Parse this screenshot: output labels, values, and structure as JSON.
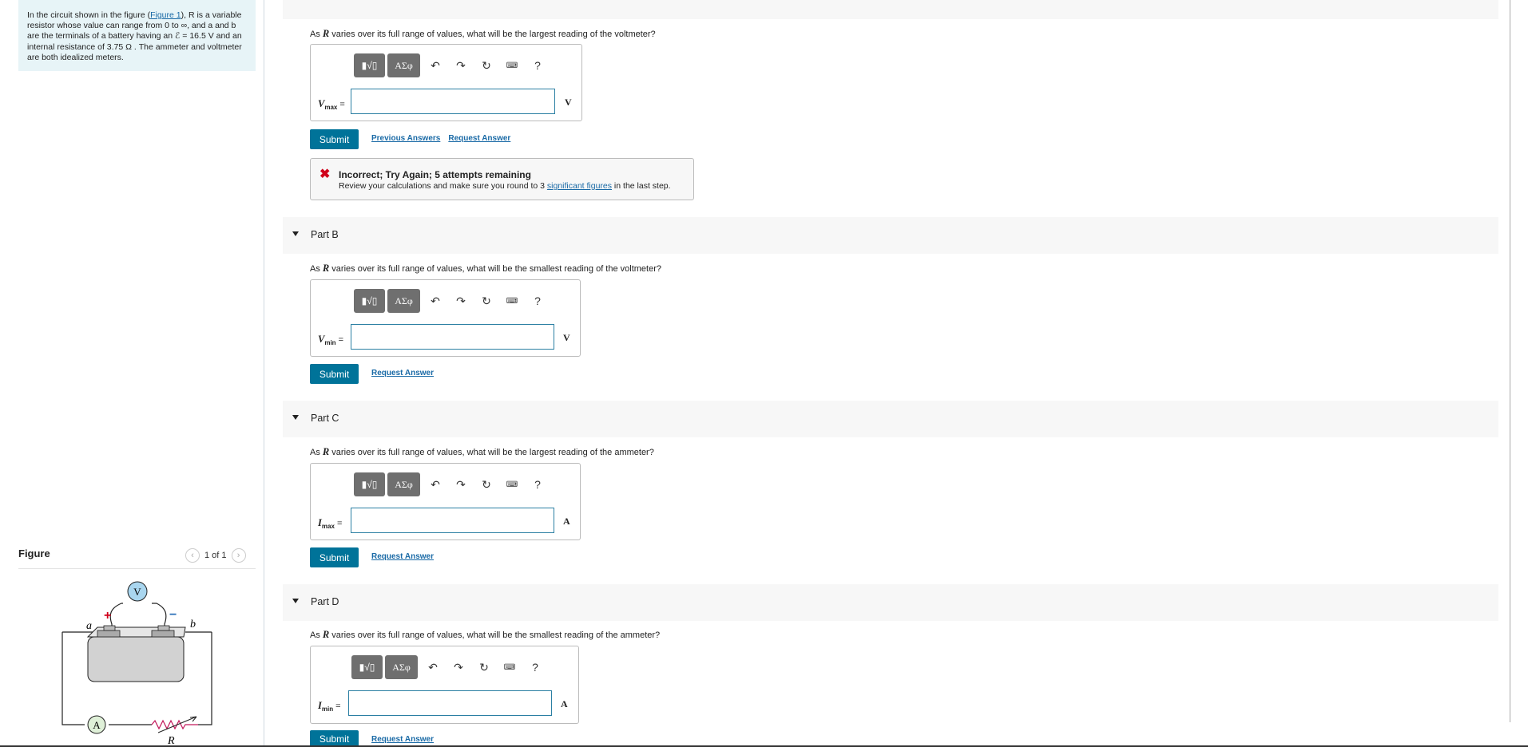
{
  "problem": {
    "intro_prefix": "In the circuit shown in the figure (",
    "figure_link": "Figure 1",
    "intro_rest": "), R is a variable resistor whose value can range from 0 to ∞, and a and b are the terminals of a battery having an ℰ = 16.5 V and an internal resistance of 3.75 Ω . The ammeter and voltmeter are both idealized meters."
  },
  "figure": {
    "title": "Figure",
    "counter": "1 of 1",
    "prev_glyph": "‹",
    "next_glyph": "›",
    "labels": {
      "voltmeter": "V",
      "ammeter": "A",
      "a": "a",
      "b": "b",
      "R": "R",
      "plus": "+",
      "minus": "−"
    }
  },
  "toolbar": {
    "templates": "▮√▯",
    "symbols": "ΑΣφ",
    "undo": "↶",
    "redo": "↷",
    "reset": "↻",
    "keyboard": "⌨",
    "help": "?"
  },
  "parts": [
    {
      "question_pre": "As ",
      "var": "R",
      "question_post": " varies over its full range of values, what will be the largest reading of the voltmeter?",
      "label_main": "V",
      "label_sub": "max",
      "eq": " =",
      "unit": "V",
      "submit": "Submit",
      "links": [
        "Previous Answers",
        "Request Answer"
      ],
      "feedback": {
        "title": "Incorrect; Try Again; 5 attempts remaining",
        "pre": "Review your calculations and make sure you round to 3 ",
        "link": "significant figures",
        "post": " in the last step."
      }
    },
    {
      "header": "Part B",
      "question_pre": "As ",
      "var": "R",
      "question_post": " varies over its full range of values, what will be the smallest reading of the voltmeter?",
      "label_main": "V",
      "label_sub": "min",
      "eq": " =",
      "unit": "V",
      "submit": "Submit",
      "links": [
        "Request Answer"
      ]
    },
    {
      "header": "Part C",
      "question_pre": "As ",
      "var": "R",
      "question_post": " varies over its full range of values, what will be the largest reading of the ammeter?",
      "label_main": "I",
      "label_sub": "max",
      "eq": " =",
      "unit": "A",
      "submit": "Submit",
      "links": [
        "Request Answer"
      ]
    },
    {
      "header": "Part D",
      "question_pre": "As ",
      "var": "R",
      "question_post": " varies over its full range of values, what will be the smallest reading of the ammeter?",
      "label_main": "I",
      "label_sub": "min",
      "eq": " =",
      "unit": "A",
      "submit": "Submit",
      "links": [
        "Request Answer"
      ]
    }
  ]
}
